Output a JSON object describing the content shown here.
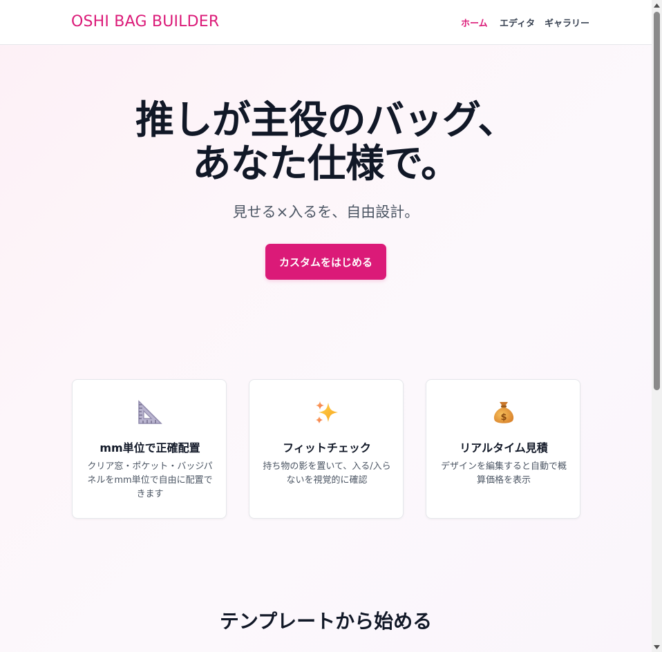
{
  "header": {
    "logo": "OSHI BAG BUILDER",
    "nav": [
      {
        "label": "ホーム",
        "active": true
      },
      {
        "label": "エディタ",
        "active": false
      },
      {
        "label": "ギャラリー",
        "active": false
      }
    ]
  },
  "hero": {
    "title_line1": "推しが主役のバッグ、",
    "title_line2": "あなた仕様で。",
    "subtitle": "見せる×入るを、自由設計。",
    "cta_label": "カスタムをはじめる"
  },
  "features": [
    {
      "icon": "triangle-ruler-icon",
      "title": "mm単位で正確配置",
      "desc": "クリア窓・ポケット・バッジパネルをmm単位で自由に配置できます"
    },
    {
      "icon": "sparkles-icon",
      "title": "フィットチェック",
      "desc": "持ち物の影を置いて、入る/入らないを視覚的に確認"
    },
    {
      "icon": "money-bag-icon",
      "title": "リアルタイム見積",
      "desc": "デザインを編集すると自動で概算価格を表示"
    }
  ],
  "templates": {
    "title": "テンプレートから始める"
  },
  "colors": {
    "accent": "#db1a78",
    "text": "#111827",
    "muted": "#4b5563",
    "border": "#e5e7eb"
  }
}
